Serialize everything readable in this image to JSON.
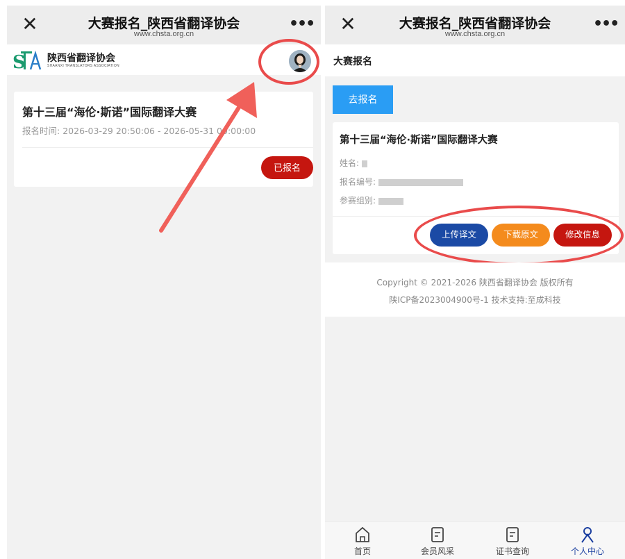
{
  "window": {
    "title": "大赛报名_陕西省翻译协会",
    "url": "www.chsta.org.cn",
    "close_icon": "close-icon",
    "more_icon": "more-icon"
  },
  "left": {
    "logo": {
      "mark": "STA",
      "name": "陕西省翻译协会",
      "sub": "SHAANXI TRANSLATORS ASSOCIATION"
    },
    "card": {
      "title": "第十三届“海伦·斯诺”国际翻译大赛",
      "time_label": "报名时间:",
      "time_value": "2026-03-29 20:50:06 - 2026-05-31 00:00:00",
      "status_button": "已报名"
    }
  },
  "right": {
    "section_title": "大赛报名",
    "register_button": "去报名",
    "card": {
      "title": "第十三届“海伦·斯诺”国际翻译大赛",
      "name_label": "姓名:",
      "number_label": "报名编号:",
      "group_label": "参赛组别:",
      "upload_button": "上传译文",
      "download_button": "下载原文",
      "modify_button": "修改信息"
    },
    "footer": {
      "line1": "Copyright © 2021-2026  陕西省翻译协会  版权所有",
      "line2": "陕ICP备2023004900号-1    技术支持:至成科技"
    },
    "tabs": [
      {
        "label": "首页",
        "icon": "home-icon"
      },
      {
        "label": "会员风采",
        "icon": "document-icon"
      },
      {
        "label": "证书查询",
        "icon": "certificate-icon"
      },
      {
        "label": "个人中心",
        "icon": "user-icon",
        "active": true
      }
    ]
  },
  "colors": {
    "red": "#c5160f",
    "blue": "#1b4aa5",
    "orange": "#f48b1d",
    "sky": "#2a9df4",
    "annotation": "#e94b4b"
  }
}
